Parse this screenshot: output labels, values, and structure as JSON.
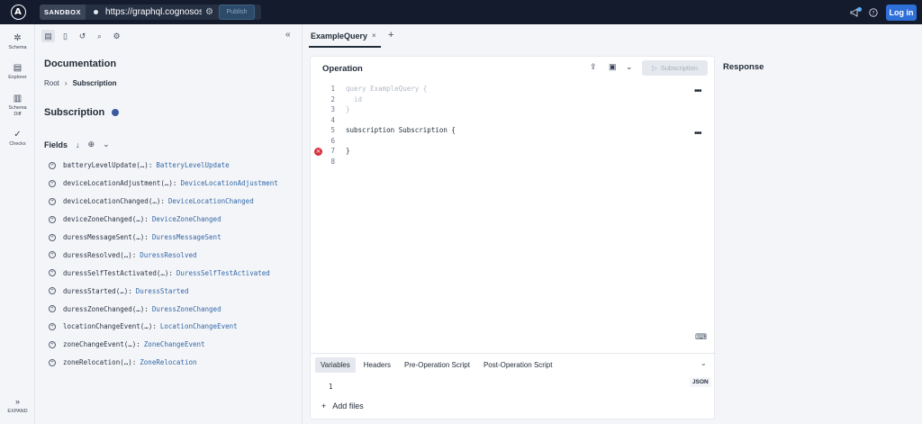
{
  "topbar": {
    "logo_letter": "A",
    "sandbox_label": "SANDBOX",
    "url": "https://graphql.cognosos",
    "publish_label": "Publish",
    "login_label": "Log in"
  },
  "leftnav": {
    "items": [
      {
        "label": "Schema",
        "icon": "schema-icon"
      },
      {
        "label": "Explorer",
        "icon": "explorer-icon"
      },
      {
        "label": "Schema Diff",
        "icon": "schema-diff-icon"
      },
      {
        "label": "Checks",
        "icon": "checks-icon"
      }
    ],
    "expand_label": "EXPAND"
  },
  "docs": {
    "title": "Documentation",
    "breadcrumb": {
      "root": "Root",
      "current": "Subscription"
    },
    "type_title": "Subscription",
    "fields_label": "Fields",
    "fields": [
      {
        "name": "batteryLevelUpdate(…):",
        "type": "BatteryLevelUpdate"
      },
      {
        "name": "deviceLocationAdjustment(…):",
        "type": "DeviceLocationAdjustment"
      },
      {
        "name": "deviceLocationChanged(…):",
        "type": "DeviceLocationChanged"
      },
      {
        "name": "deviceZoneChanged(…):",
        "type": "DeviceZoneChanged"
      },
      {
        "name": "duressMessageSent(…):",
        "type": "DuressMessageSent"
      },
      {
        "name": "duressResolved(…):",
        "type": "DuressResolved"
      },
      {
        "name": "duressSelfTestActivated(…):",
        "type": "DuressSelfTestActivated"
      },
      {
        "name": "duressStarted(…):",
        "type": "DuressStarted"
      },
      {
        "name": "duressZoneChanged(…):",
        "type": "DuressZoneChanged"
      },
      {
        "name": "locationChangeEvent(…):",
        "type": "LocationChangeEvent"
      },
      {
        "name": "zoneChangeEvent(…):",
        "type": "ZoneChangeEvent"
      },
      {
        "name": "zoneRelocation(…):",
        "type": "ZoneRelocation"
      }
    ]
  },
  "tabs": {
    "active_label": "ExampleQuery",
    "close_glyph": "×",
    "add_glyph": "+"
  },
  "operation": {
    "title": "Operation",
    "run_label": "Subscription",
    "lines": [
      {
        "n": "1",
        "code": "query ExampleQuery {",
        "dim": true
      },
      {
        "n": "2",
        "code": "  id",
        "dim": true
      },
      {
        "n": "3",
        "code": "}",
        "dim": true
      },
      {
        "n": "4",
        "code": "",
        "dim": false
      },
      {
        "n": "5",
        "code": "subscription Subscription {",
        "dim": false
      },
      {
        "n": "6",
        "code": "",
        "dim": false
      },
      {
        "n": "7",
        "code": "}",
        "dim": false
      },
      {
        "n": "8",
        "code": "",
        "dim": false
      }
    ]
  },
  "variables": {
    "tabs": [
      "Variables",
      "Headers",
      "Pre-Operation Script",
      "Post-Operation Script"
    ],
    "line_number": "1",
    "json_badge": "JSON",
    "add_files_label": "Add files"
  },
  "response": {
    "title": "Response"
  }
}
